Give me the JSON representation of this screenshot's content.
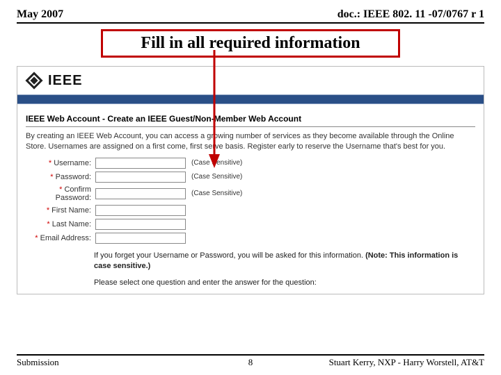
{
  "header": {
    "date": "May 2007",
    "doc": "doc.: IEEE 802. 11 -07/0767 r 1"
  },
  "title": "Fill in all required information",
  "screenshot": {
    "logo_text": "IEEE",
    "section_heading": "IEEE Web Account - Create an IEEE Guest/Non-Member Web Account",
    "intro": "By creating an IEEE Web Account, you can access a growing number of services as they become available through the Online Store. Usernames are assigned on a first come, first serve basis. Register early to reserve the Username that's best for you.",
    "fields": [
      {
        "label": "Username:",
        "required": true,
        "hint": "(Case Sensitive)"
      },
      {
        "label": "Password:",
        "required": true,
        "hint": "(Case Sensitive)"
      },
      {
        "label": "Confirm Password:",
        "required": true,
        "hint": "(Case Sensitive)"
      },
      {
        "label": "First Name:",
        "required": true,
        "hint": ""
      },
      {
        "label": "Last Name:",
        "required": true,
        "hint": ""
      },
      {
        "label": "Email Address:",
        "required": true,
        "hint": ""
      }
    ],
    "note_prefix": "If you forget your Username or Password, you will be asked for this information. ",
    "note_bold": "(Note: This information is case sensitive.)",
    "question_prompt": "Please select one question and enter the answer for the question:"
  },
  "footer": {
    "left": "Submission",
    "center": "8",
    "right": "Stuart Kerry, NXP - Harry Worstell, AT&T"
  }
}
